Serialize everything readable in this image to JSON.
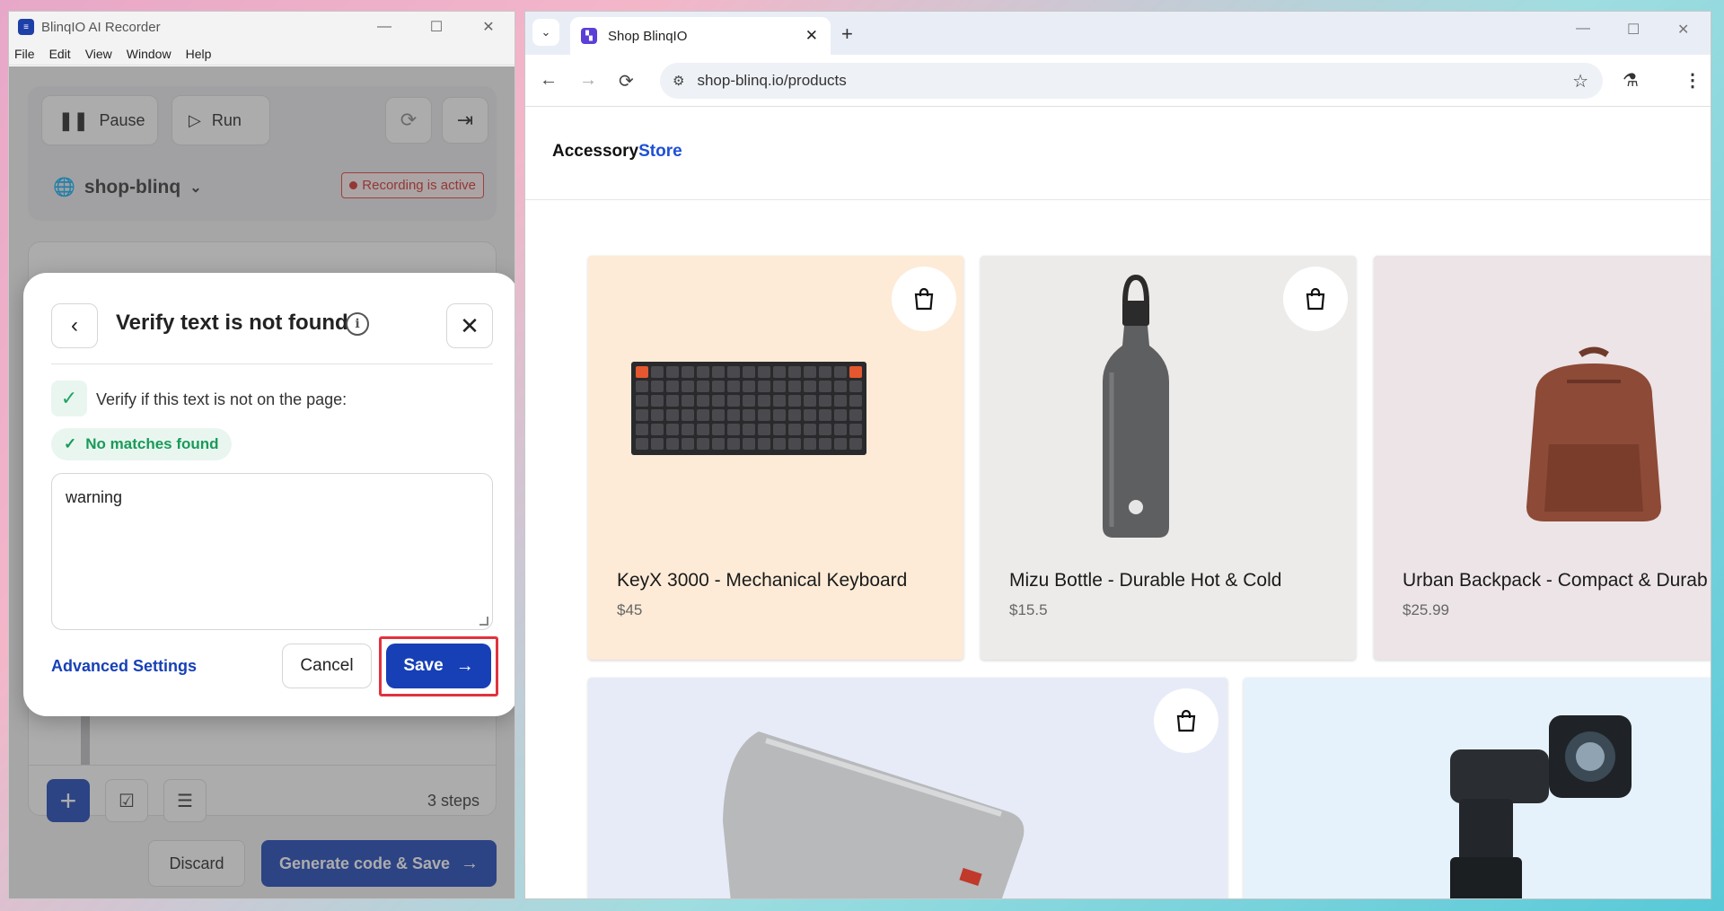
{
  "recorder": {
    "title": "BlinqIO AI Recorder",
    "menu": [
      "File",
      "Edit",
      "View",
      "Window",
      "Help"
    ],
    "pause_label": "Pause",
    "run_label": "Run",
    "project": "shop-blinq",
    "recording_status": "Recording is active",
    "steps_count": "3 steps",
    "discard_label": "Discard",
    "generate_label": "Generate code & Save"
  },
  "modal": {
    "title": "Verify text is not found",
    "verify_label": "Verify if this text is not on the page:",
    "match_status": "No matches found",
    "text_value": "warning",
    "advanced_label": "Advanced Settings",
    "cancel_label": "Cancel",
    "save_label": "Save"
  },
  "browser": {
    "tab_title": "Shop BlinqIO",
    "url": "shop-blinq.io/products"
  },
  "store": {
    "logo_main": "Accessory",
    "logo_accent": "Store",
    "products": [
      {
        "name": "KeyX 3000 - Mechanical Keyboard",
        "price": "$45"
      },
      {
        "name": "Mizu Bottle - Durable Hot & Cold",
        "price": "$15.5"
      },
      {
        "name": "Urban Backpack - Compact & Durab",
        "price": "$25.99"
      }
    ]
  },
  "colors": {
    "brand_blue": "#1740b7",
    "recording_red": "#d12a2a",
    "success_green": "#1a9a5a",
    "highlight_red": "#e0333e"
  }
}
